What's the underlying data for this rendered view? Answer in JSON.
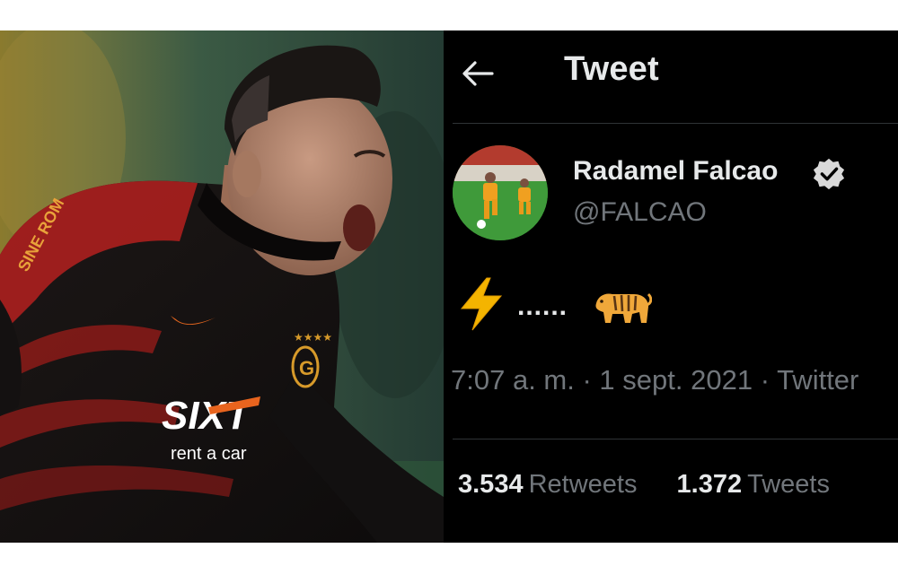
{
  "header": {
    "title": "Tweet"
  },
  "author": {
    "display_name": "Radamel Falcao",
    "handle": "@FALCAO",
    "verified": true
  },
  "tweet": {
    "emoji_start": "lightning-emoji",
    "text_middle": "......",
    "emoji_end": "tiger-emoji"
  },
  "meta": {
    "time": "7:07 a. m.",
    "date": "1 sept. 2021",
    "source": "Twitter"
  },
  "stats": {
    "retweets_count": "3.534",
    "retweets_label": "Retweets",
    "quotes_count": "1.372",
    "quotes_label": "Tweets"
  },
  "photo_text": {
    "sponsor_logo": "SIXT",
    "sponsor_tagline": "rent a car",
    "sleeve_text": "SINE ROM"
  },
  "colors": {
    "background": "#000000",
    "primary_text": "#e7e9ea",
    "secondary_text": "#71767b",
    "divider": "#2f3336",
    "verified_badge": "#d9d9d9",
    "lightning": "#f4b400",
    "tiger": "#f0a83a",
    "shirt_red": "#b5201e",
    "shirt_black": "#151313"
  }
}
